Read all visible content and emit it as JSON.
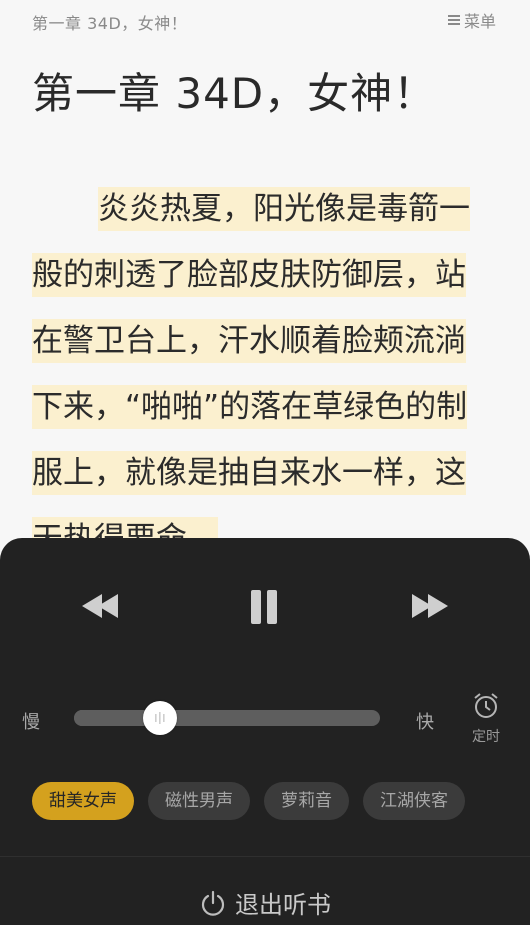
{
  "header": {
    "title": "第一章 34D，女神！",
    "menu_label": "菜单"
  },
  "chapter": {
    "title": "第一章  34D，女神！"
  },
  "content": {
    "lines": [
      "炎炎热夏，阳光像是毒箭一",
      "般的刺透了脸部皮肤防御层，站",
      "在警卫台上，汗水顺着脸颊流淌",
      "下来，“啪啪”的落在草绿色的制",
      "服上，就像是抽自来水一样，这",
      "天热得要命，"
    ],
    "highlight_color": "#fbf0cf"
  },
  "player": {
    "speed_slow_label": "慢",
    "speed_fast_label": "快",
    "speed_value": 0.28,
    "timer_label": "定时",
    "voices": [
      {
        "label": "甜美女声",
        "active": true
      },
      {
        "label": "磁性男声",
        "active": false
      },
      {
        "label": "萝莉音",
        "active": false
      },
      {
        "label": "江湖侠客",
        "active": false
      }
    ],
    "exit_label": "退出听书",
    "accent_color": "#d4a11e"
  }
}
